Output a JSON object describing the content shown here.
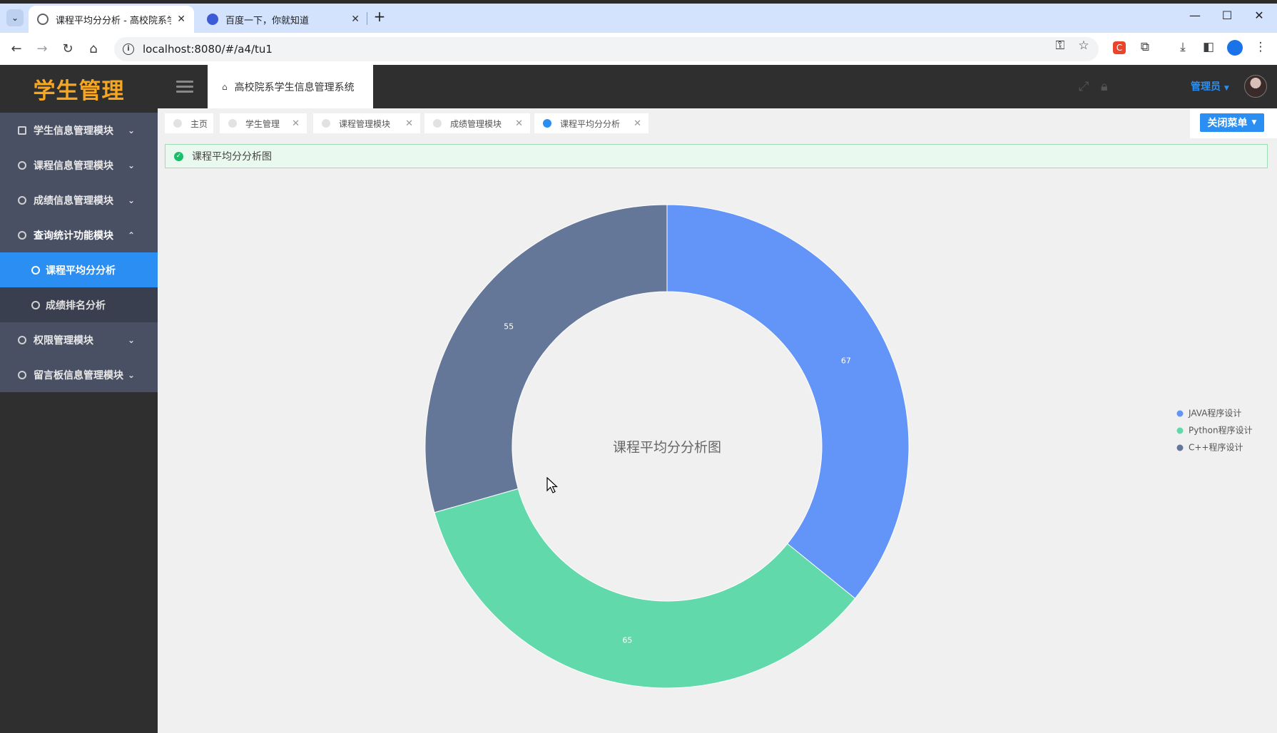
{
  "browser": {
    "tabs": [
      {
        "title": "课程平均分分析 - 高校院系学生",
        "active": true
      },
      {
        "title": "百度一下，你就知道",
        "active": false
      }
    ],
    "url": "localhost:8080/#/a4/tu1"
  },
  "sidebar": {
    "logo": "学生管理",
    "items": [
      {
        "label": "学生信息管理模块",
        "chevron": "⌄"
      },
      {
        "label": "课程信息管理模块",
        "chevron": "⌄"
      },
      {
        "label": "成绩信息管理模块",
        "chevron": "⌄"
      },
      {
        "label": "查询统计功能模块",
        "chevron": "⌃"
      },
      {
        "label": "权限管理模块",
        "chevron": "⌄"
      },
      {
        "label": "留言板信息管理模块",
        "chevron": "⌄"
      }
    ],
    "subitems": [
      {
        "label": "课程平均分分析",
        "active": true
      },
      {
        "label": "成绩排名分析",
        "active": false
      }
    ]
  },
  "topbar": {
    "system_title": "高校院系学生信息管理系统",
    "admin_label": "管理员"
  },
  "page_tabs": [
    {
      "label": "主页",
      "closable": false,
      "active": false
    },
    {
      "label": "学生管理",
      "closable": true,
      "active": false
    },
    {
      "label": "课程管理模块",
      "closable": true,
      "active": false
    },
    {
      "label": "成绩管理模块",
      "closable": true,
      "active": false
    },
    {
      "label": "课程平均分分析",
      "closable": true,
      "active": true
    }
  ],
  "close_menu_label": "关闭菜单",
  "alert_text": "课程平均分分析图",
  "colors": {
    "accent": "#2b8ef3",
    "logo": "#f5a623",
    "success": "#19be6b"
  },
  "chart_data": {
    "type": "pie",
    "variant": "donut",
    "title": "课程平均分分析图",
    "categories": [
      "JAVA程序设计",
      "Python程序设计",
      "C++程序设计"
    ],
    "values": [
      67,
      65,
      55
    ],
    "colors": [
      "#6394f8",
      "#62d9aa",
      "#657798"
    ],
    "legend": "right",
    "show_labels": true
  }
}
